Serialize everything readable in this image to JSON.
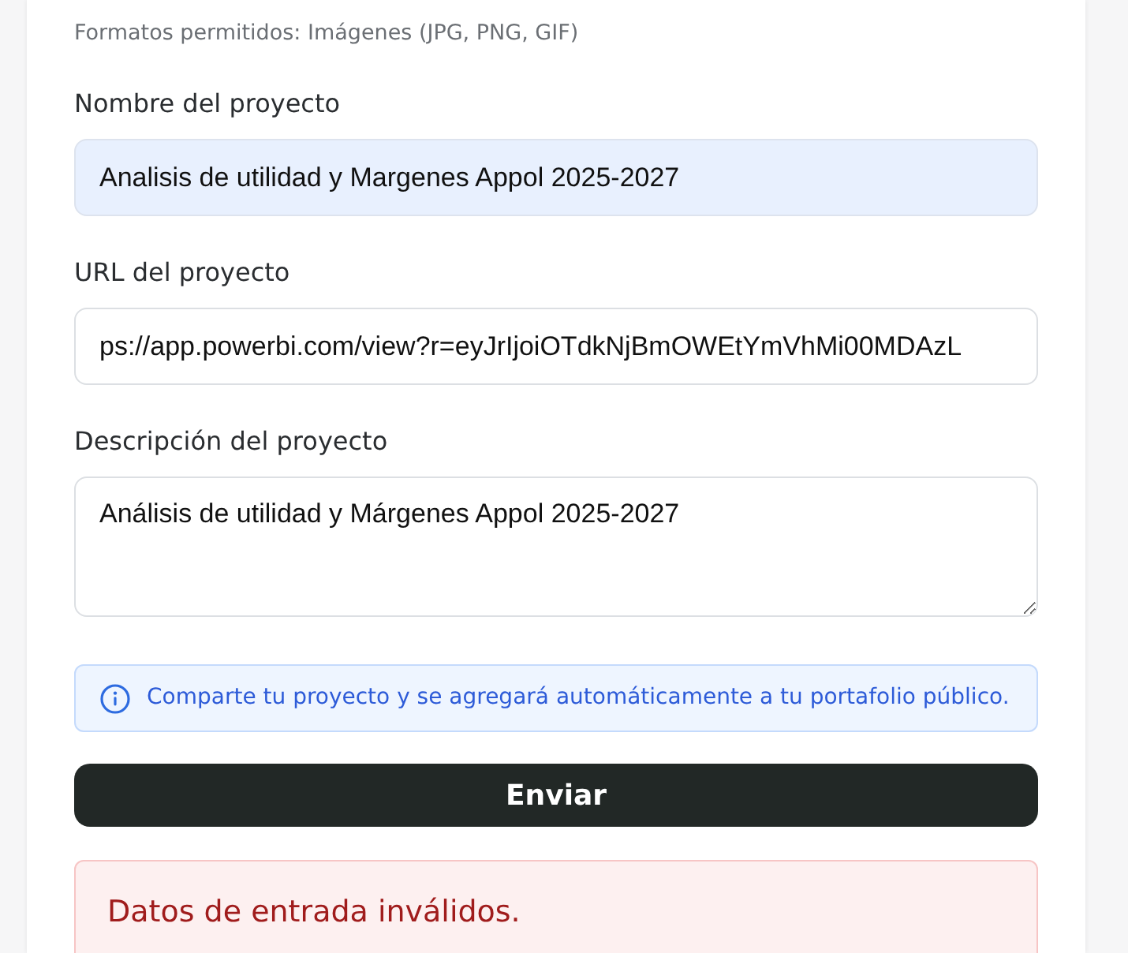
{
  "formats_hint": "Formatos permitidos: Imágenes (JPG, PNG, GIF)",
  "fields": [
    {
      "kind": "input",
      "label": "Nombre del proyecto",
      "value": "Analisis de utilidad y Margenes Appol 2025-2027",
      "autofilled": true
    },
    {
      "kind": "input",
      "label": "URL del proyecto",
      "value": "ps://app.powerbi.com/view?r=eyJrIjoiOTdkNjBmOWEtYmVhMi00MDAzL",
      "autofilled": false
    },
    {
      "kind": "textarea",
      "label": "Descripción del proyecto",
      "value": "Análisis de utilidad y Márgenes Appol 2025-2027",
      "autofilled": false
    }
  ],
  "info_alert": "Comparte tu proyecto y se agregará automáticamente a tu portafolio público.",
  "submit_button": "Enviar",
  "error_alert": "Datos de entrada inválidos."
}
